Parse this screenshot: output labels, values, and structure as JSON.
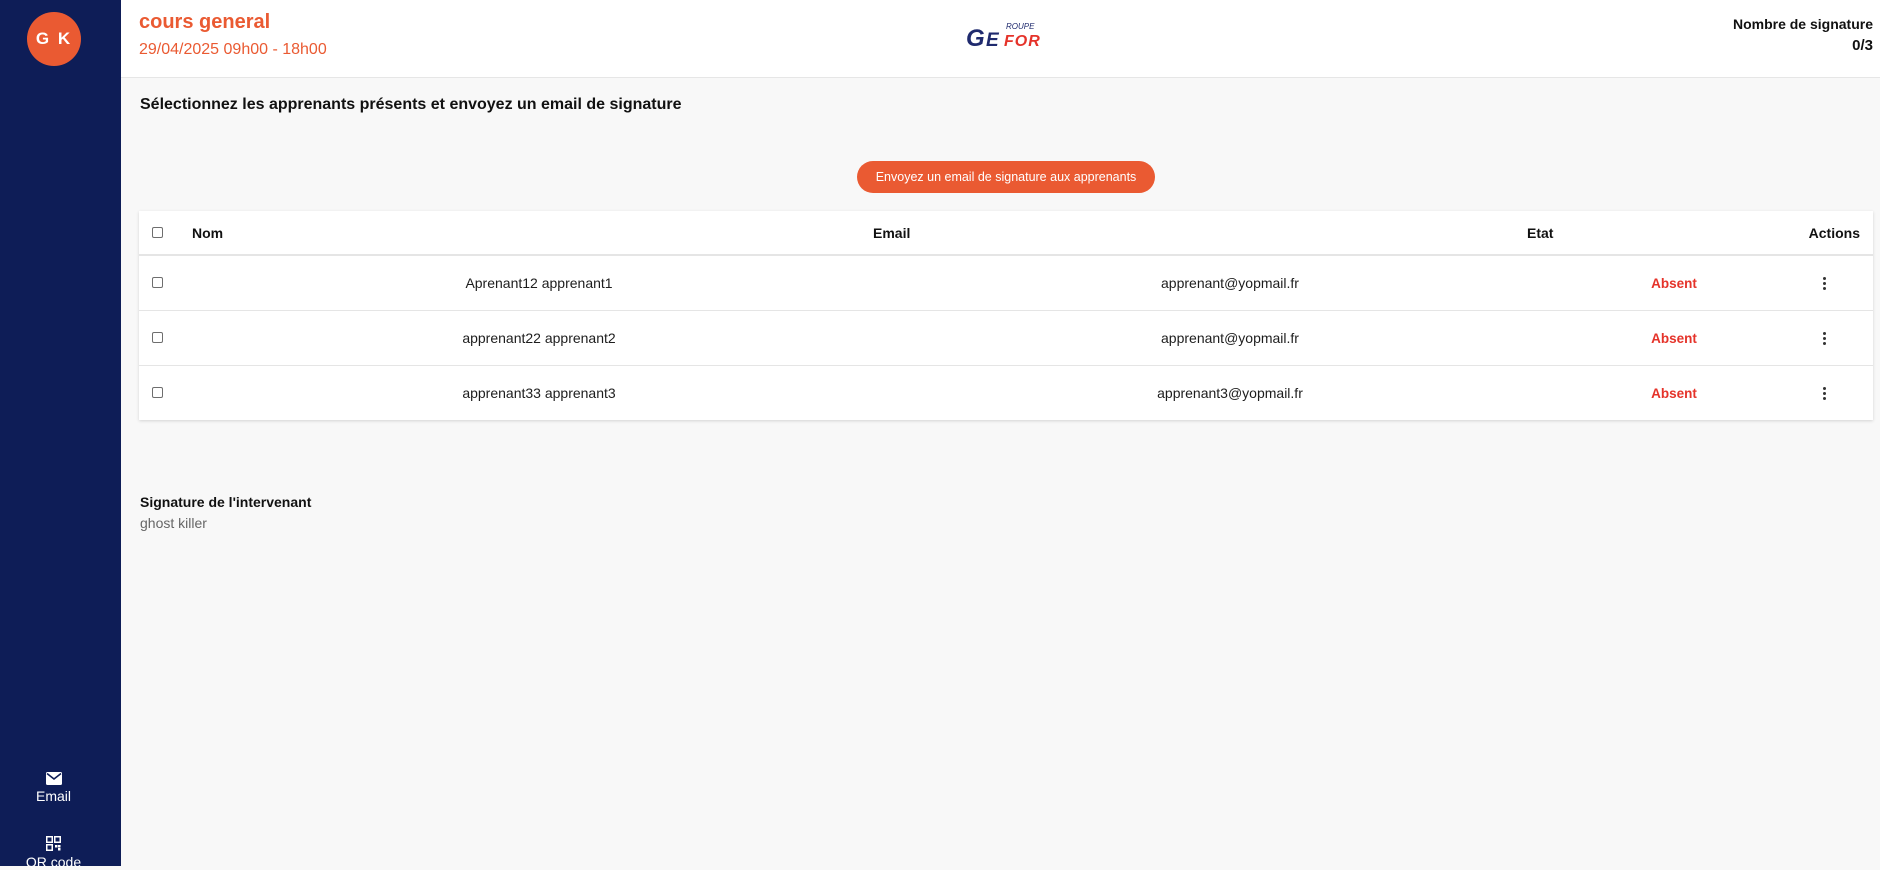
{
  "sidebar": {
    "avatar_initials": "G K",
    "nav": [
      {
        "label": "Email",
        "icon": "mail-icon"
      },
      {
        "label": "QR code",
        "icon": "qr-code-icon"
      }
    ]
  },
  "header": {
    "course_title": "cours general",
    "course_date": "29/04/2025 09h00 - 18h00",
    "logo": {
      "small_text": "ROUPE",
      "brand_g": "G",
      "brand_e": "E",
      "brand_for": "FOR"
    },
    "signature_count_label": "Nombre de signature",
    "signature_count_value": "0/3"
  },
  "main": {
    "instructions": "Sélectionnez les apprenants présents et envoyez un email de signature",
    "send_button_label": "Envoyez un email de signature aux apprenants",
    "table": {
      "columns": [
        "Nom",
        "Email",
        "Etat",
        "Actions"
      ],
      "rows": [
        {
          "name": "Aprenant12 apprenant1",
          "email": "apprenant@yopmail.fr",
          "status": "Absent"
        },
        {
          "name": "apprenant22 apprenant2",
          "email": "apprenant@yopmail.fr",
          "status": "Absent"
        },
        {
          "name": "apprenant33 apprenant3",
          "email": "apprenant3@yopmail.fr",
          "status": "Absent"
        }
      ]
    },
    "signature_section": {
      "label": "Signature de l'intervenant",
      "name": "ghost killer"
    }
  },
  "colors": {
    "sidebar_bg": "#0e1d57",
    "accent": "#ea5a32",
    "absent": "#e5332a",
    "logo_navy": "#1f2a6e",
    "logo_red": "#e5332a"
  }
}
